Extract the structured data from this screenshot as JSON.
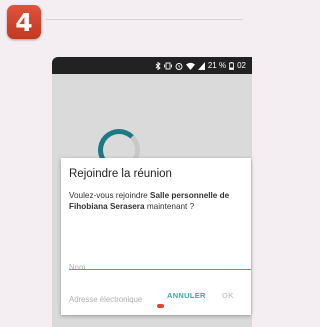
{
  "step_number": "4",
  "status_bar": {
    "icons": [
      "bluetooth-icon",
      "vibrate-icon",
      "alarm-icon",
      "wifi-icon",
      "signal-icon",
      "battery-icon"
    ],
    "battery_percent": "21 %",
    "time": "02"
  },
  "dialog": {
    "title": "Rejoindre la réunion",
    "message_prefix": "Voulez-vous rejoindre ",
    "room_name": "Salle personnelle de Fihobiana Serasera",
    "message_suffix": " maintenant ?",
    "name_placeholder": "Nom",
    "email_placeholder": "Adresse électronique",
    "cancel_label": "ANNULER",
    "ok_label": "OK"
  },
  "colors": {
    "badge": "#d2432b",
    "accent": "#3aa7b7",
    "spinner": "#1d7a83"
  }
}
